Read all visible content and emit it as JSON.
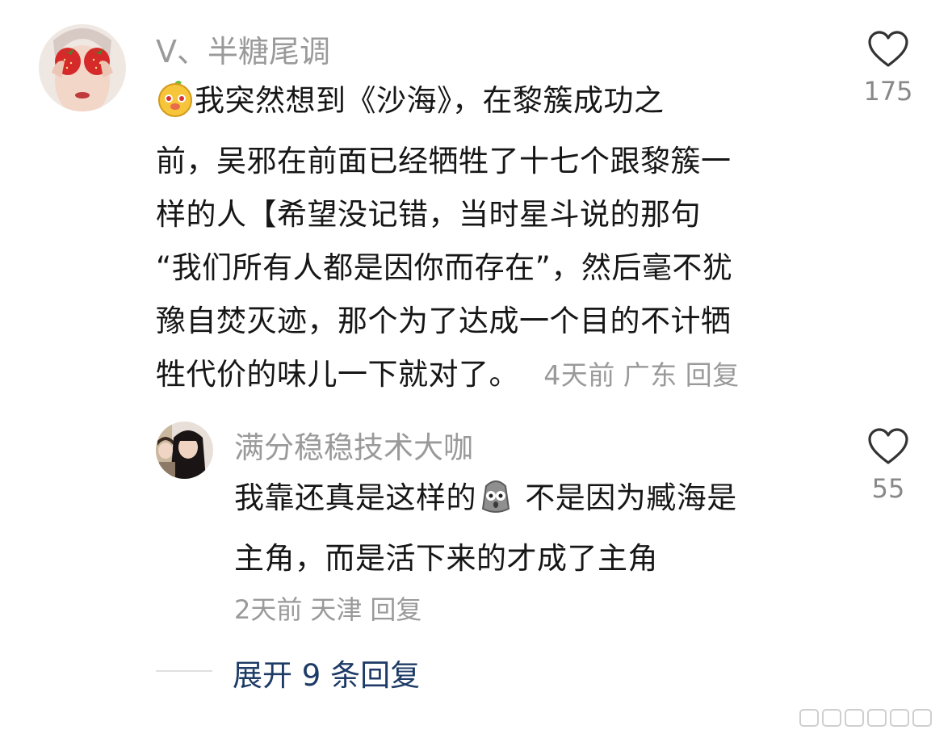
{
  "comments": [
    {
      "username": "V、半糖尾调",
      "avatar": "strawberry-eyes-avatar",
      "lines": [
        "我突然想到《沙海》，在黎簇成功之",
        "前，吴邪在前面已经牺牲了十七个跟黎簇一",
        "样的人【希望没记错，当时星斗说的那句",
        "“我们所有人都是因你而存在”，然后毫不犹",
        "豫自焚灭迹，那个为了达成一个目的不计牺",
        "牲代价的味儿一下就对了。"
      ],
      "leading_emoji": "cute-face-emoji",
      "time": "4天前",
      "location": "广东",
      "reply": "回复",
      "likes": "175"
    }
  ],
  "replies": [
    {
      "username": "满分稳稳技术大咖",
      "avatar": "girl-photo-avatar",
      "text_before_emoji": "我靠还真是这样的",
      "inline_emoji": "shocked-face-emoji",
      "text_after_emoji": " 不是因为臧海是",
      "line2": "主角，而是活下来的才成了主角",
      "time": "2天前",
      "location": "天津",
      "reply": "回复",
      "likes": "55"
    }
  ],
  "expand_label": "展开 9 条回复",
  "colors": {
    "username": "#9a9a9a",
    "text": "#161616",
    "meta": "#9a9a9a",
    "link": "#1d3b66",
    "like_outline": "#333333"
  }
}
